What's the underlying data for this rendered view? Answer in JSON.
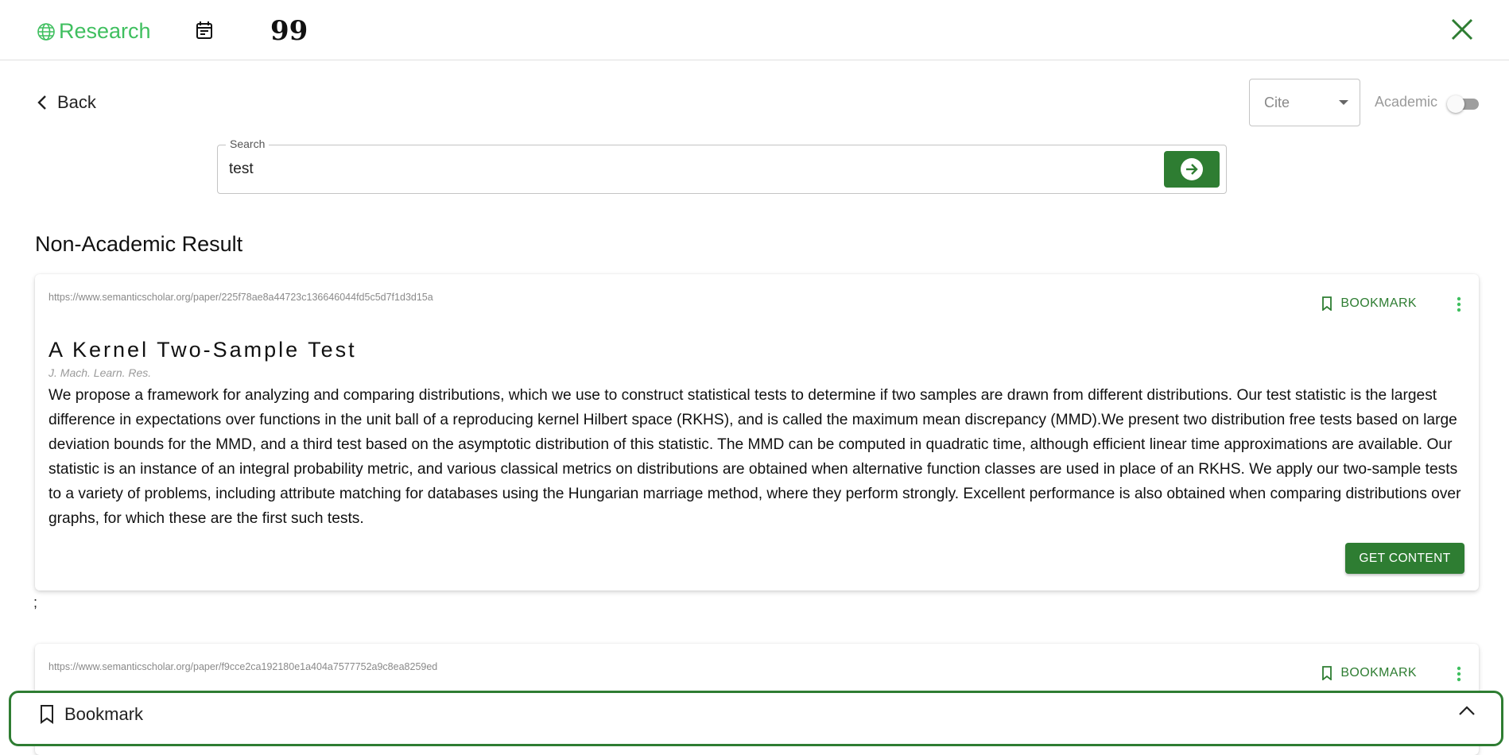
{
  "header": {
    "brand_label": "Research",
    "icons": [
      "globe-icon",
      "calendar-icon",
      "quote-icon",
      "close-icon"
    ],
    "quote_glyph": "99"
  },
  "nav": {
    "back_label": "Back"
  },
  "controls": {
    "cite_value": "Cite",
    "academic_label": "Academic",
    "academic_enabled": false
  },
  "search": {
    "legend": "Search",
    "value": "test"
  },
  "results": {
    "section_title": "Non-Academic Result",
    "separator": ";",
    "items": [
      {
        "url": "https://www.semanticscholar.org/paper/225f78ae8a44723c136646044fd5c5d7f1d3d15a",
        "bookmark_label": "BOOKMARK",
        "title": "A Kernel Two-Sample Test",
        "journal": "J. Mach. Learn. Res.",
        "abstract": "We propose a framework for analyzing and comparing distributions, which we use to construct statistical tests to determine if two samples are drawn from different distributions. Our test statistic is the largest difference in expectations over functions in the unit ball of a reproducing kernel Hilbert space (RKHS), and is called the maximum mean discrepancy (MMD).We present two distribution free tests based on large deviation bounds for the MMD, and a third test based on the asymptotic distribution of this statistic. The MMD can be computed in quadratic time, although efficient linear time approximations are available. Our statistic is an instance of an integral probability metric, and various classical metrics on distributions are obtained when alternative function classes are used in place of an RKHS. We apply our two-sample tests to a variety of problems, including attribute matching for databases using the Hungarian marriage method, where they perform strongly. Excellent performance is also obtained when comparing distributions over graphs, for which these are the first such tests.",
        "get_content_label": "GET CONTENT"
      },
      {
        "url": "https://www.semanticscholar.org/paper/f9cce2ca192180e1a404a7577752a9c8ea8259ed",
        "bookmark_label": "BOOKMARK"
      }
    ]
  },
  "bookmark_panel": {
    "label": "Bookmark"
  },
  "colors": {
    "brand_green": "#3fbf5f",
    "primary_green": "#2e7d32",
    "muted_text": "#8a8a8a"
  }
}
